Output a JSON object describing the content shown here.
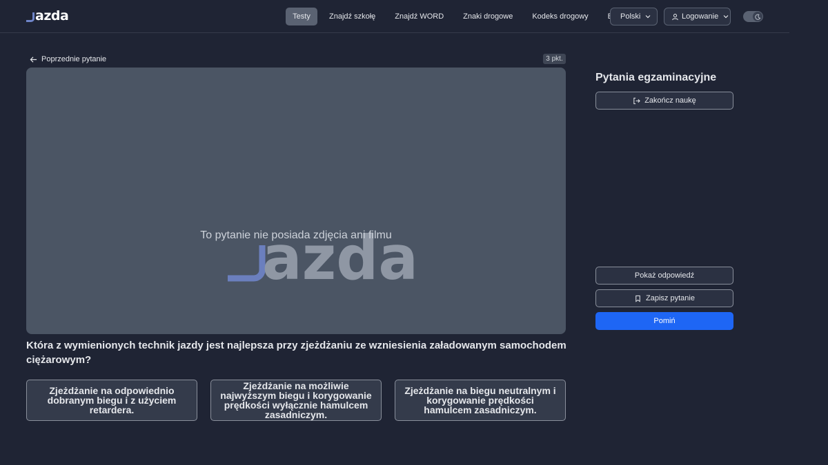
{
  "brand": {
    "logo_text": "azda",
    "big_logo_text": "azda",
    "accent": "#6f85c9"
  },
  "nav": {
    "items": [
      "Testy",
      "Znajdź szkołę",
      "Znajdź WORD",
      "Znaki drogowe",
      "Kodeks drogowy",
      "Blog"
    ],
    "active": "Testy",
    "language": "Polski",
    "login": "Logowanie"
  },
  "question_view": {
    "back_label": "Poprzednie pytanie",
    "points": "3 pkt.",
    "no_media_text": "To pytanie nie posiada zdjęcia ani filmu",
    "question": "Która z wymienionych technik jazdy jest najlepsza przy zjeżdżaniu ze wzniesienia załadowanym samochodem ciężarowym?",
    "answers": [
      "Zjeżdżanie na odpowiednio dobranym biegu i z użyciem retardera.",
      "Zjeżdżanie na możliwie najwyższym biegu i korygowanie prędkości wyłącznie hamulcem zasadniczym.",
      "Zjeżdżanie na biegu neutralnym i korygowanie prędkości hamulcem zasadniczym."
    ]
  },
  "sidebar": {
    "title": "Pytania egzaminacyjne",
    "end_label": "Zakończ naukę",
    "show_answer_label": "Pokaż odpowiedź",
    "save_label": "Zapisz pytanie",
    "skip_label": "Pomiń",
    "skip_color": "#1e66f5"
  }
}
